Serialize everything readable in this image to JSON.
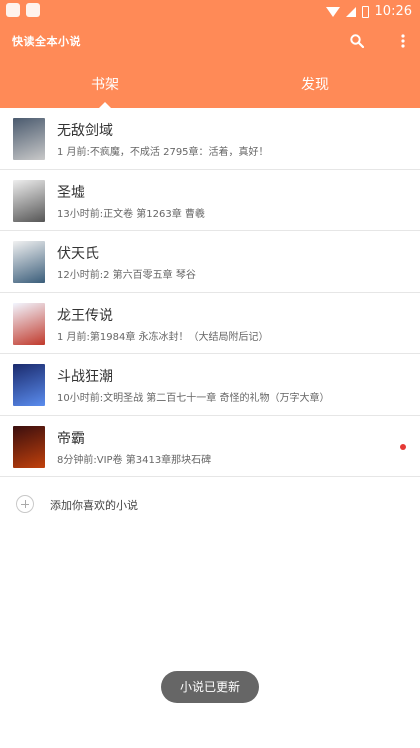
{
  "status_bar": {
    "time": "10:26",
    "icons": [
      "app-notification-icon",
      "a-notification-icon",
      "wifi-icon",
      "signal-icon",
      "battery-icon"
    ]
  },
  "app_bar": {
    "title": "快读全本小说",
    "actions": [
      "search-icon",
      "more-vert-icon"
    ],
    "background": "#ff8a57"
  },
  "tabs": [
    {
      "label": "书架",
      "selected": true
    },
    {
      "label": "发现",
      "selected": false
    }
  ],
  "books": [
    {
      "title": "无敌剑域",
      "latest": "1 月前:不疯魔，不成活 2795章：活着，真好！",
      "cover_colors": [
        "#4a5a6e",
        "#c9c9c9"
      ],
      "has_update": false
    },
    {
      "title": "圣墟",
      "latest": "13小时前:正文卷 第1263章 曹羲",
      "cover_colors": [
        "#eeeeee",
        "#555555"
      ],
      "has_update": false
    },
    {
      "title": "伏天氏",
      "latest": "12小时前:2 第六百零五章 琴谷",
      "cover_colors": [
        "#f1f1f1",
        "#3a5d7a"
      ],
      "has_update": false
    },
    {
      "title": "龙王传说",
      "latest": "1 月前:第1984章 永冻冰封！（大结局附后记）",
      "cover_colors": [
        "#f2f6ff",
        "#c0392b"
      ],
      "has_update": false
    },
    {
      "title": "斗战狂潮",
      "latest": "10小时前:文明圣战 第二百七十一章 奇怪的礼物（万字大章）",
      "cover_colors": [
        "#1a2a6c",
        "#5b8def"
      ],
      "has_update": false
    },
    {
      "title": "帝霸",
      "latest": "8分钟前:VIP卷 第3413章那块石碑",
      "cover_colors": [
        "#3a0e0e",
        "#c2410c"
      ],
      "has_update": true
    }
  ],
  "add_favorite": {
    "label": "添加你喜欢的小说"
  },
  "toast": {
    "text": "小说已更新"
  },
  "colors": {
    "accent": "#ff8a57",
    "update_dot": "#e53935",
    "toast_bg": "#666666"
  }
}
